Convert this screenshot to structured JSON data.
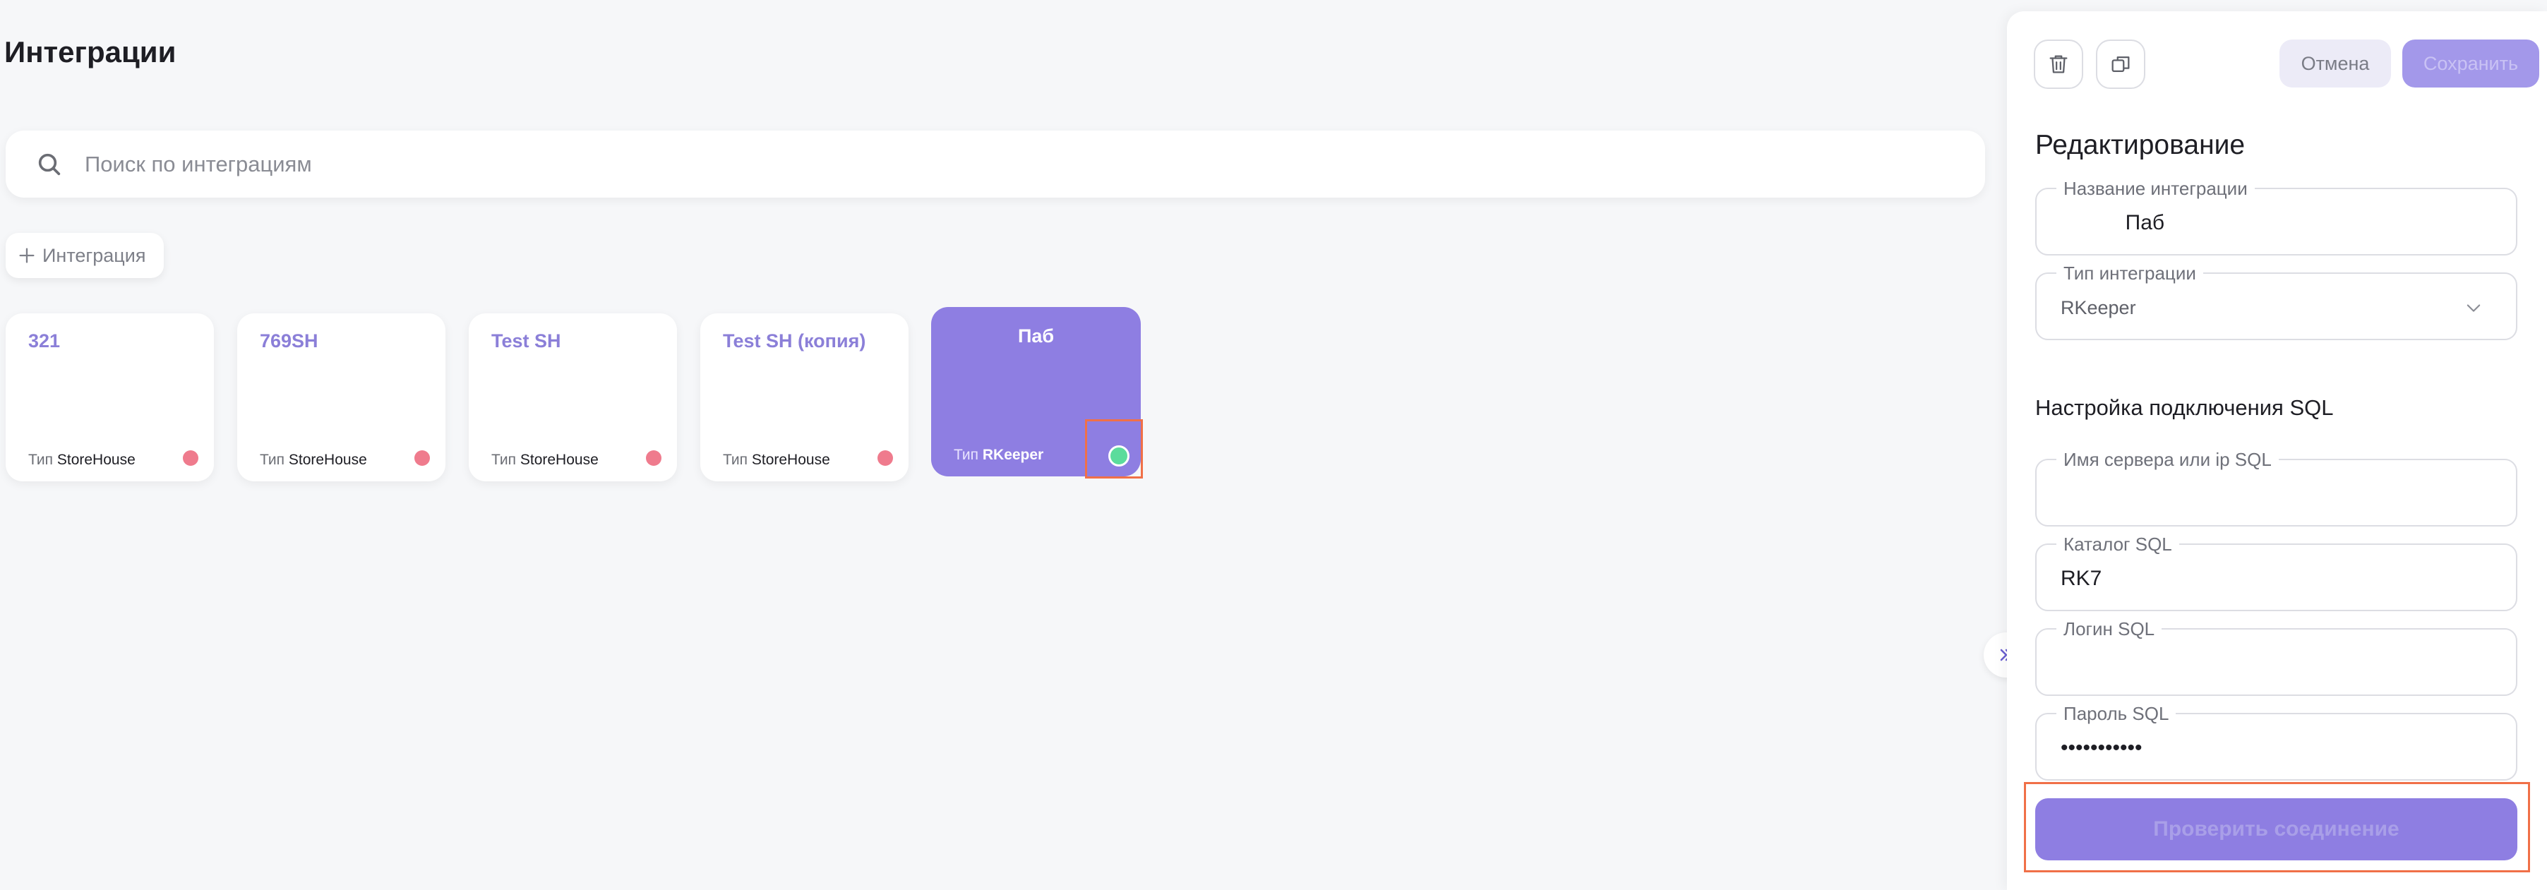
{
  "page": {
    "title": "Интеграции"
  },
  "search": {
    "placeholder": "Поиск по интеграциям",
    "icon": "search-icon"
  },
  "add_button": {
    "label": "Интеграция",
    "icon": "plus-icon"
  },
  "cards": [
    {
      "title": "321",
      "type_label": "Тип",
      "type_value": "StoreHouse",
      "status_color": "#ef7b8d"
    },
    {
      "title": "769SH",
      "type_label": "Тип",
      "type_value": "StoreHouse",
      "status_color": "#ef7b8d"
    },
    {
      "title": "Test SH",
      "type_label": "Тип",
      "type_value": "StoreHouse",
      "status_color": "#ef7b8d"
    },
    {
      "title": "Test SH (копия)",
      "type_label": "Тип",
      "type_value": "StoreHouse",
      "status_color": "#ef7b8d"
    },
    {
      "title": "Паб",
      "type_label": "Тип",
      "type_value": "RKeeper",
      "status_color": "#5bdc9c",
      "active": true
    }
  ],
  "panel": {
    "delete_icon": "trash-icon",
    "copy_icon": "copy-icon",
    "cancel_label": "Отмена",
    "save_label": "Сохранить",
    "title": "Редактирование",
    "fields": {
      "name": {
        "label": "Название интеграции",
        "value": "           Паб"
      },
      "type": {
        "label": "Тип интеграции",
        "value": "RKeeper"
      },
      "server": {
        "label": "Имя сервера или ip SQL",
        "value": ""
      },
      "catalog": {
        "label": "Каталог SQL",
        "value": "RK7"
      },
      "login": {
        "label": "Логин SQL",
        "value": ""
      },
      "password": {
        "label": "Пароль SQL",
        "value": "•••••••••••"
      }
    },
    "section_title": "Настройка подключения SQL",
    "check_button_label": "Проверить соединение"
  },
  "colors": {
    "accent": "#8e7ee2",
    "status_error": "#ef7b8d",
    "status_ok": "#5bdc9c",
    "highlight": "#f07048"
  }
}
